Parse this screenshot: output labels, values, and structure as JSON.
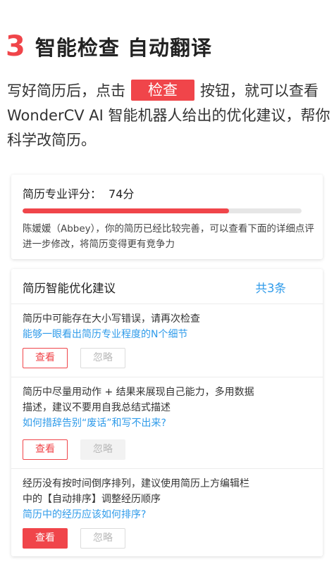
{
  "header": {
    "step_number": "3",
    "title": "智能检查 自动翻译"
  },
  "intro": {
    "before": "写好简历后，点击",
    "button": "检查",
    "after": "按钮，就可以查看WonderCV AI 智能机器人给出的优化建议，帮你科学改简历。"
  },
  "score_card": {
    "label": "简历专业评分：",
    "value": "74分",
    "progress_percent": 74,
    "description": "陈媛媛（Abbey），你的简历已经比较完善，可以查看下面的详细点评进一步修改，将简历变得更有竞争力"
  },
  "suggestions": {
    "title": "简历智能优化建议",
    "count": "共3条",
    "items": [
      {
        "text": "简历中可能存在大小写错误，请再次检查",
        "link": "能够一眼看出简历专业程度的N个细节",
        "view_label": "查看",
        "ignore_label": "忽略"
      },
      {
        "text": "简历中尽量用动作 + 结果来展现自己能力，多用数据描述，建议不要用自我总结式描述",
        "link": "如何措辞告别“废话”和写不出来?",
        "view_label": "查看",
        "ignore_label": "忽略"
      },
      {
        "text": "经历没有按时间倒序排列，建议使用简历上方编辑栏中的【自动排序】调整经历顺序",
        "link": "简历中的经历应该如何排序?",
        "view_label": "查看",
        "ignore_label": "忽略"
      }
    ]
  },
  "colors": {
    "accent": "#f0454a",
    "link": "#2f9bea"
  }
}
